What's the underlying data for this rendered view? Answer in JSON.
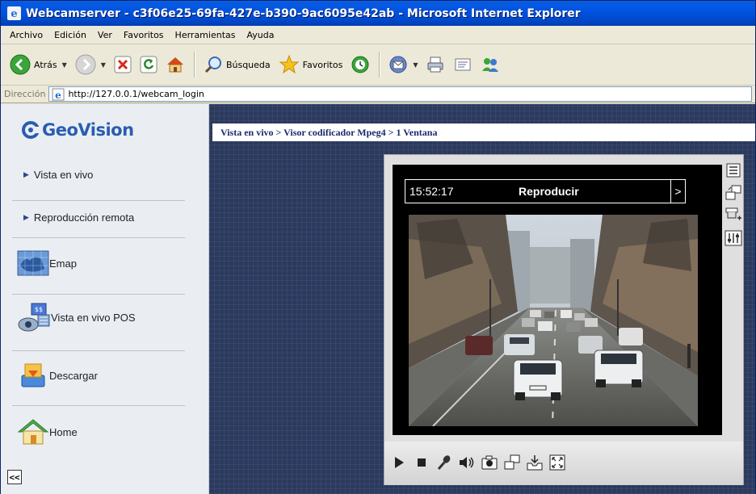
{
  "window": {
    "title": "Webcamserver - c3f06e25-69fa-427e-b390-9ac6095e42ab - Microsoft Internet Explorer"
  },
  "menu": [
    "Archivo",
    "Edición",
    "Ver",
    "Favoritos",
    "Herramientas",
    "Ayuda"
  ],
  "toolbar": {
    "back_label": "Atrás",
    "search_label": "Búsqueda",
    "favorites_label": "Favoritos"
  },
  "address": {
    "label": "Dirección",
    "url": "http://127.0.0.1/webcam_login"
  },
  "sidebar": {
    "logo_text": "GeoVision",
    "items": [
      {
        "label": "Vista en vivo"
      },
      {
        "label": "Reproducción remota"
      },
      {
        "label": "Emap"
      },
      {
        "label": "Vista en vivo POS"
      },
      {
        "label": "Descargar"
      },
      {
        "label": "Home"
      }
    ],
    "collapse_label": "<<"
  },
  "main": {
    "breadcrumb": "Vista en vivo > Visor codificador Mpeg4 > 1 Ventana"
  },
  "viewer": {
    "time": "15:52:17",
    "mode": "Reproducir",
    "next": ">"
  },
  "colors": {
    "titlebar": "#0054e3",
    "main_bg": "#2b3a5e",
    "sidebar_bg": "#eaeef3",
    "breadcrumb_text": "#1a2a6c",
    "logo": "#2a5db0"
  }
}
